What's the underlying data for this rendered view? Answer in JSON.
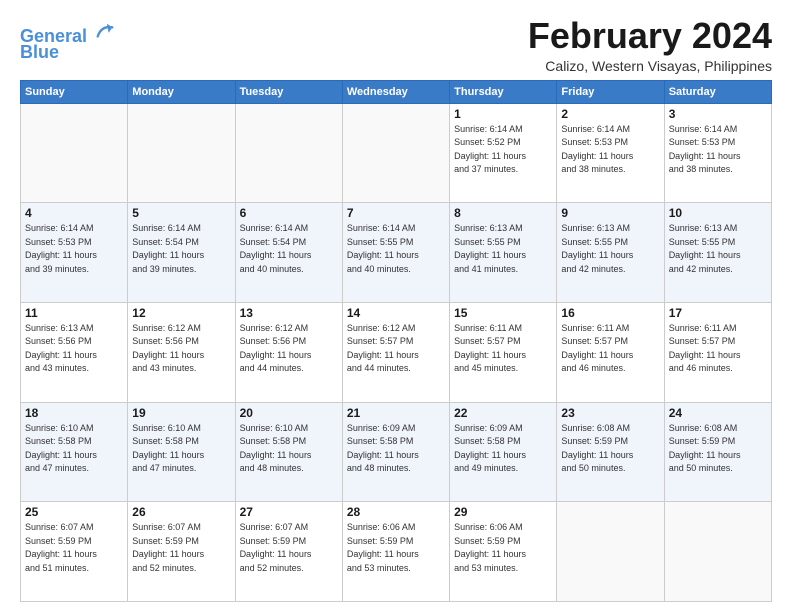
{
  "header": {
    "logo_line1": "General",
    "logo_line2": "Blue",
    "month": "February 2024",
    "location": "Calizo, Western Visayas, Philippines"
  },
  "days_of_week": [
    "Sunday",
    "Monday",
    "Tuesday",
    "Wednesday",
    "Thursday",
    "Friday",
    "Saturday"
  ],
  "weeks": [
    [
      {
        "day": "",
        "info": ""
      },
      {
        "day": "",
        "info": ""
      },
      {
        "day": "",
        "info": ""
      },
      {
        "day": "",
        "info": ""
      },
      {
        "day": "1",
        "info": "Sunrise: 6:14 AM\nSunset: 5:52 PM\nDaylight: 11 hours\nand 37 minutes."
      },
      {
        "day": "2",
        "info": "Sunrise: 6:14 AM\nSunset: 5:53 PM\nDaylight: 11 hours\nand 38 minutes."
      },
      {
        "day": "3",
        "info": "Sunrise: 6:14 AM\nSunset: 5:53 PM\nDaylight: 11 hours\nand 38 minutes."
      }
    ],
    [
      {
        "day": "4",
        "info": "Sunrise: 6:14 AM\nSunset: 5:53 PM\nDaylight: 11 hours\nand 39 minutes."
      },
      {
        "day": "5",
        "info": "Sunrise: 6:14 AM\nSunset: 5:54 PM\nDaylight: 11 hours\nand 39 minutes."
      },
      {
        "day": "6",
        "info": "Sunrise: 6:14 AM\nSunset: 5:54 PM\nDaylight: 11 hours\nand 40 minutes."
      },
      {
        "day": "7",
        "info": "Sunrise: 6:14 AM\nSunset: 5:55 PM\nDaylight: 11 hours\nand 40 minutes."
      },
      {
        "day": "8",
        "info": "Sunrise: 6:13 AM\nSunset: 5:55 PM\nDaylight: 11 hours\nand 41 minutes."
      },
      {
        "day": "9",
        "info": "Sunrise: 6:13 AM\nSunset: 5:55 PM\nDaylight: 11 hours\nand 42 minutes."
      },
      {
        "day": "10",
        "info": "Sunrise: 6:13 AM\nSunset: 5:55 PM\nDaylight: 11 hours\nand 42 minutes."
      }
    ],
    [
      {
        "day": "11",
        "info": "Sunrise: 6:13 AM\nSunset: 5:56 PM\nDaylight: 11 hours\nand 43 minutes."
      },
      {
        "day": "12",
        "info": "Sunrise: 6:12 AM\nSunset: 5:56 PM\nDaylight: 11 hours\nand 43 minutes."
      },
      {
        "day": "13",
        "info": "Sunrise: 6:12 AM\nSunset: 5:56 PM\nDaylight: 11 hours\nand 44 minutes."
      },
      {
        "day": "14",
        "info": "Sunrise: 6:12 AM\nSunset: 5:57 PM\nDaylight: 11 hours\nand 44 minutes."
      },
      {
        "day": "15",
        "info": "Sunrise: 6:11 AM\nSunset: 5:57 PM\nDaylight: 11 hours\nand 45 minutes."
      },
      {
        "day": "16",
        "info": "Sunrise: 6:11 AM\nSunset: 5:57 PM\nDaylight: 11 hours\nand 46 minutes."
      },
      {
        "day": "17",
        "info": "Sunrise: 6:11 AM\nSunset: 5:57 PM\nDaylight: 11 hours\nand 46 minutes."
      }
    ],
    [
      {
        "day": "18",
        "info": "Sunrise: 6:10 AM\nSunset: 5:58 PM\nDaylight: 11 hours\nand 47 minutes."
      },
      {
        "day": "19",
        "info": "Sunrise: 6:10 AM\nSunset: 5:58 PM\nDaylight: 11 hours\nand 47 minutes."
      },
      {
        "day": "20",
        "info": "Sunrise: 6:10 AM\nSunset: 5:58 PM\nDaylight: 11 hours\nand 48 minutes."
      },
      {
        "day": "21",
        "info": "Sunrise: 6:09 AM\nSunset: 5:58 PM\nDaylight: 11 hours\nand 48 minutes."
      },
      {
        "day": "22",
        "info": "Sunrise: 6:09 AM\nSunset: 5:58 PM\nDaylight: 11 hours\nand 49 minutes."
      },
      {
        "day": "23",
        "info": "Sunrise: 6:08 AM\nSunset: 5:59 PM\nDaylight: 11 hours\nand 50 minutes."
      },
      {
        "day": "24",
        "info": "Sunrise: 6:08 AM\nSunset: 5:59 PM\nDaylight: 11 hours\nand 50 minutes."
      }
    ],
    [
      {
        "day": "25",
        "info": "Sunrise: 6:07 AM\nSunset: 5:59 PM\nDaylight: 11 hours\nand 51 minutes."
      },
      {
        "day": "26",
        "info": "Sunrise: 6:07 AM\nSunset: 5:59 PM\nDaylight: 11 hours\nand 52 minutes."
      },
      {
        "day": "27",
        "info": "Sunrise: 6:07 AM\nSunset: 5:59 PM\nDaylight: 11 hours\nand 52 minutes."
      },
      {
        "day": "28",
        "info": "Sunrise: 6:06 AM\nSunset: 5:59 PM\nDaylight: 11 hours\nand 53 minutes."
      },
      {
        "day": "29",
        "info": "Sunrise: 6:06 AM\nSunset: 5:59 PM\nDaylight: 11 hours\nand 53 minutes."
      },
      {
        "day": "",
        "info": ""
      },
      {
        "day": "",
        "info": ""
      }
    ]
  ]
}
